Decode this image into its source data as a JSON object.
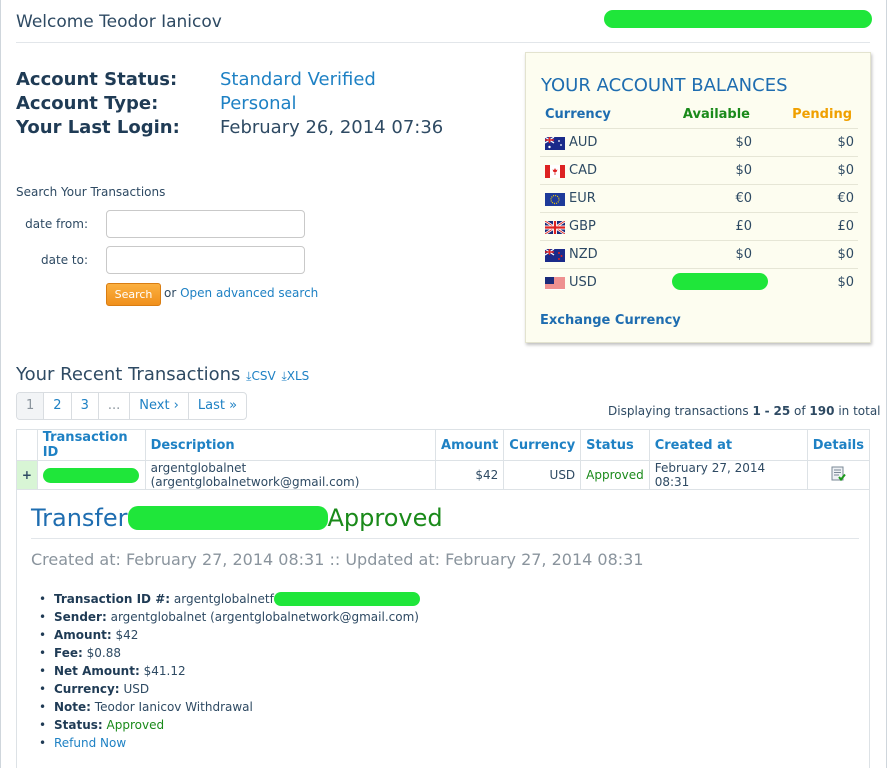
{
  "header": {
    "welcome": "Welcome Teodor Ianicov"
  },
  "account": {
    "status_label": "Account Status:",
    "status_value": "Standard Verified",
    "type_label": "Account Type:",
    "type_value": "Personal",
    "login_label": "Your Last Login:",
    "login_value": "February 26, 2014 07:36"
  },
  "search": {
    "title": "Search Your Transactions",
    "date_from_label": "date from:",
    "date_to_label": "date to:",
    "date_from_value": "",
    "date_to_value": "",
    "button": "Search",
    "or": "or",
    "advanced": "Open advanced search"
  },
  "balances": {
    "title": "YOUR ACCOUNT BALANCES",
    "col_currency": "Currency",
    "col_available": "Available",
    "col_pending": "Pending",
    "available_color": "#1a8a1a",
    "pending_color": "#f0a000",
    "rows": [
      {
        "code": "AUD",
        "available": "$0",
        "pending": "$0",
        "flag": "australia-flag"
      },
      {
        "code": "CAD",
        "available": "$0",
        "pending": "$0",
        "flag": "canada-flag"
      },
      {
        "code": "EUR",
        "available": "€0",
        "pending": "€0",
        "flag": "eu-flag"
      },
      {
        "code": "GBP",
        "available": "£0",
        "pending": "£0",
        "flag": "uk-flag"
      },
      {
        "code": "NZD",
        "available": "$0",
        "pending": "$0",
        "flag": "new-zealand-flag"
      },
      {
        "code": "USD",
        "available": "",
        "pending": "$0",
        "flag": "usa-flag"
      }
    ],
    "exchange": "Exchange Currency"
  },
  "recent": {
    "title": "Your Recent Transactions",
    "csv": "CSV",
    "xls": "XLS",
    "pager": [
      "1",
      "2",
      "3",
      "...",
      "Next ›",
      "Last »"
    ],
    "display_prefix": "Displaying transactions",
    "range_from": "1",
    "range_sep": "-",
    "range_to": "25",
    "of": "of",
    "total": "190",
    "suffix": "in total"
  },
  "table": {
    "headers": [
      "Transaction ID",
      "Description",
      "Amount",
      "Currency",
      "Status",
      "Created at",
      "Details"
    ],
    "row": {
      "expand": "+",
      "description": "argentglobalnet (argentglobalnetwork@gmail.com)",
      "amount": "$42",
      "currency": "USD",
      "status": "Approved",
      "created": "February 27, 2014 08:31"
    }
  },
  "detail": {
    "title_prefix": "Transfer",
    "title_status": "Approved",
    "created_line": "Created at: February 27, 2014 08:31 :: Updated at: February 27, 2014 08:31",
    "items": [
      {
        "label": "Transaction ID #:",
        "value": "argentglobalnetf"
      },
      {
        "label": "Sender:",
        "value": "argentglobalnet (argentglobalnetwork@gmail.com)"
      },
      {
        "label": "Amount:",
        "value": "$42"
      },
      {
        "label": "Fee:",
        "value": "$0.88"
      },
      {
        "label": "Net Amount:",
        "value": "$41.12"
      },
      {
        "label": "Currency:",
        "value": "USD"
      },
      {
        "label": "Note:",
        "value": "Teodor Ianicov Withdrawal"
      },
      {
        "label": "Status:",
        "value": "Approved"
      }
    ],
    "refund": "Refund Now"
  }
}
